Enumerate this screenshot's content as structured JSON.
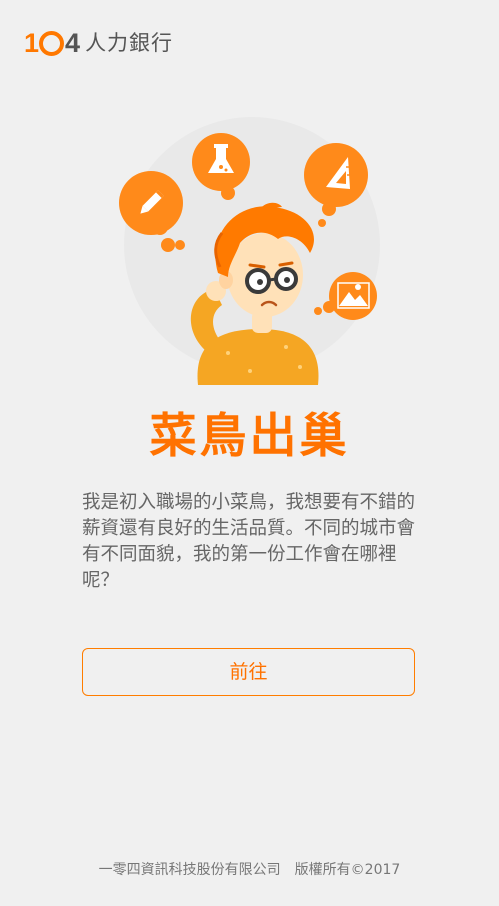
{
  "header": {
    "logo_number_1": "1",
    "logo_number_4": "4",
    "logo_text": "人力銀行"
  },
  "hero": {
    "title": "菜鳥出巢",
    "description": "我是初入職場的小菜鳥，我想要有不錯的薪資還有良好的生活品質。不同的城市會有不同面貌，我的第一份工作會在哪裡呢？"
  },
  "actions": {
    "go_label": "前往"
  },
  "footer": {
    "company": "一零四資訊科技股份有限公司",
    "copyright": "版權所有©2017"
  },
  "colors": {
    "accent": "#ff7200",
    "background": "#f0f0f0",
    "text": "#666666"
  },
  "icons": [
    "pencil-icon",
    "flask-icon",
    "ruler-icon",
    "image-icon"
  ]
}
